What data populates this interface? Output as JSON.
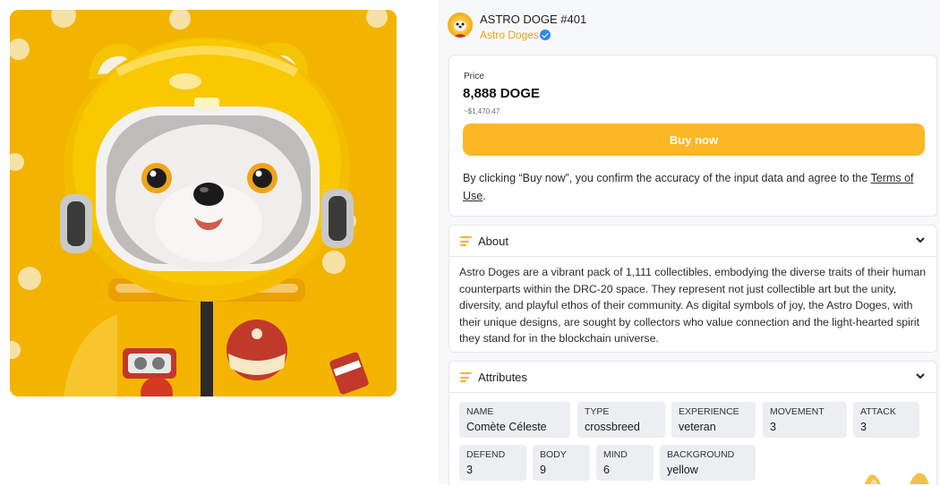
{
  "item": {
    "title": "ASTRO DOGE #401",
    "collection": "Astro Doges"
  },
  "price": {
    "label": "Price",
    "value": "8,888 DOGE",
    "usd": "~$1,470.47",
    "buy_label": "Buy now",
    "disclaimer_prefix": "By clicking “Buy now”, you confirm the accuracy of the input data and agree to the ",
    "terms_link": "Terms of Use",
    "disclaimer_suffix": "."
  },
  "about": {
    "title": "About",
    "text": "Astro Doges are a vibrant pack of 1,111 collectibles, embodying the diverse traits of their human counterparts within the DRC-20 space. They represent not just collectible art but the unity, diversity, and playful ethos of their community. As digital symbols of joy, the Astro Doges, with their unique designs, are sought by collectors who value connection and the light-hearted spirit they stand for in the blockchain universe."
  },
  "attributes": {
    "title": "Attributes",
    "items": [
      {
        "key": "NAME",
        "value": "Comète Céleste"
      },
      {
        "key": "TYPE",
        "value": "crossbreed"
      },
      {
        "key": "EXPERIENCE",
        "value": "veteran"
      },
      {
        "key": "MOVEMENT",
        "value": "3"
      },
      {
        "key": "ATTACK",
        "value": "3"
      },
      {
        "key": "DEFEND",
        "value": "3"
      },
      {
        "key": "BODY",
        "value": "9"
      },
      {
        "key": "MIND",
        "value": "6"
      },
      {
        "key": "BACKGROUND",
        "value": "yellow"
      }
    ]
  },
  "colors": {
    "accent": "#fbb724",
    "collection_link": "#e7a30f",
    "verified": "#2b8ae2",
    "art_background": "#f1b300"
  },
  "icons": [
    "verified-badge-icon",
    "list-icon",
    "chevron-down-icon"
  ]
}
